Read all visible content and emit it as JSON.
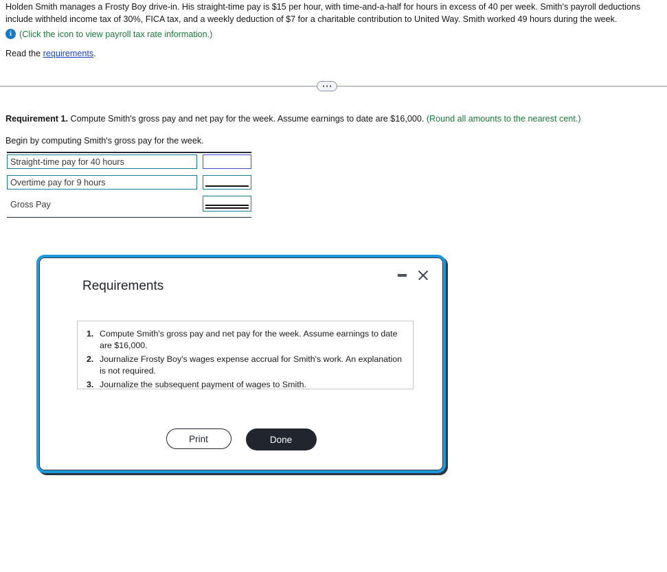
{
  "problem": {
    "statement": "Holden Smith manages a Frosty Boy drive-in. His straight-time pay is $15 per hour, with time-and-a-half for hours in excess of 40 per week. Smith's payroll deductions include withheld income tax of 30%, FICA tax, and a weekly deduction of $7 for a charitable contribution to United Way. Smith worked 49 hours during the week.",
    "icon_name": "info-icon",
    "icon_glyph": "i",
    "icon_note": "(Click the icon to view payroll tax rate information.)",
    "read_prefix": "Read the ",
    "read_link": "requirements",
    "read_suffix": "."
  },
  "divider": {
    "handle_label": "..."
  },
  "requirement": {
    "label": "Requirement 1.",
    "text": " Compute Smith's gross pay and net pay for the week. Assume earnings to date are $16,000. ",
    "rounding_note": "(Round all amounts to the nearest cent.)",
    "begin_line": "Begin by computing Smith's gross pay for the week."
  },
  "entry_table": {
    "rows": [
      {
        "label": "Straight-time pay for 40 hours",
        "value": "",
        "boxed_label": true,
        "value_style": "focused"
      },
      {
        "label": "Overtime pay for 9 hours",
        "value": "",
        "boxed_label": true,
        "value_style": "single-rule"
      },
      {
        "label": "Gross Pay",
        "value": "",
        "boxed_label": false,
        "value_style": "double-rule"
      }
    ]
  },
  "dialog": {
    "title": "Requirements",
    "minimize_name": "minimize-button",
    "close_name": "close-button",
    "items": [
      {
        "num": "1.",
        "text": "Compute Smith's gross pay and net pay for the week. Assume earnings to date are $16,000."
      },
      {
        "num": "2.",
        "text": "Journalize Frosty Boy's wages expense accrual for Smith's work. An explanation is not required."
      },
      {
        "num": "3.",
        "text": "Journalize the subsequent payment of wages to Smith."
      }
    ],
    "print_label": "Print",
    "done_label": "Done"
  },
  "colors": {
    "link": "#1b44c8",
    "green_note": "#1a7a3c",
    "teal_border": "#177e8e",
    "focus_border": "#3f4fcf",
    "dialog_accent": "#1c9ae0",
    "dark": "#20252e"
  }
}
